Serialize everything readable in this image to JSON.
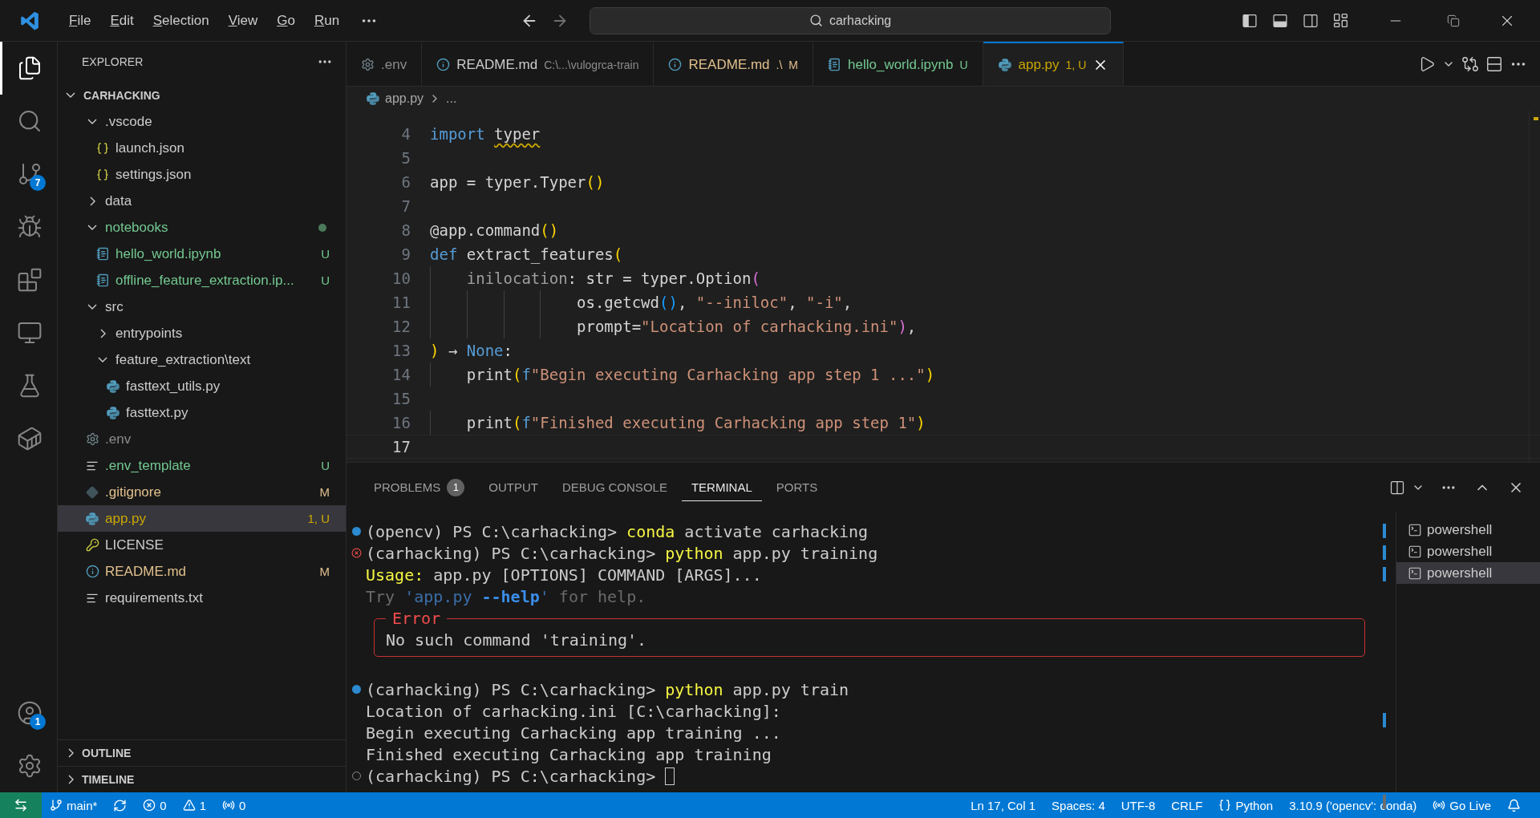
{
  "title_bar": {
    "menu": [
      "File",
      "Edit",
      "Selection",
      "View",
      "Go",
      "Run"
    ],
    "search": {
      "value": "carhacking"
    },
    "layout_toggles": [
      {
        "kind": "sidebar",
        "on": true
      },
      {
        "kind": "panel",
        "on": true
      },
      {
        "kind": "secondary",
        "on": false
      }
    ]
  },
  "activity_bar": {
    "items": [
      {
        "kind": "explorer",
        "selected": true
      },
      {
        "kind": "search",
        "selected": false
      },
      {
        "kind": "source-control",
        "selected": false,
        "badge": "7"
      },
      {
        "kind": "run",
        "selected": false
      },
      {
        "kind": "extensions",
        "selected": false
      },
      {
        "kind": "remote",
        "selected": false
      },
      {
        "kind": "testing",
        "selected": false
      },
      {
        "kind": "docker",
        "selected": false
      }
    ],
    "bottom": [
      {
        "kind": "account",
        "badge": "1"
      },
      {
        "kind": "manage"
      }
    ]
  },
  "sidebar": {
    "title": "EXPLORER",
    "root": {
      "name": "CARHACKING",
      "expanded": true
    },
    "tree": [
      {
        "name": ".vscode",
        "kind": "folder",
        "expanded": true,
        "dot": false,
        "selected": false,
        "children": [
          {
            "name": "launch.json",
            "kind": "json",
            "selected": false
          },
          {
            "name": "settings.json",
            "kind": "json",
            "selected": false
          }
        ]
      },
      {
        "name": "data",
        "kind": "folder",
        "expanded": false,
        "dot": false,
        "selected": false
      },
      {
        "name": "notebooks",
        "kind": "folder",
        "expanded": true,
        "dot": true,
        "color": "#73c991",
        "selected": false,
        "children": [
          {
            "name": "hello_world.ipynb",
            "kind": "notebook",
            "color": "#73c991",
            "decoration": "U",
            "selected": false
          },
          {
            "name": "offline_feature_extraction.ip...",
            "kind": "notebook",
            "color": "#73c991",
            "decoration": "U",
            "selected": false
          }
        ]
      },
      {
        "name": "src",
        "kind": "folder",
        "expanded": true,
        "dot": false,
        "selected": false,
        "children": [
          {
            "name": "entrypoints",
            "kind": "folder",
            "expanded": false,
            "dot": false,
            "selected": false
          },
          {
            "name": "feature_extraction\\text",
            "kind": "folder",
            "expanded": true,
            "dot": false,
            "selected": false,
            "children": [
              {
                "name": "fasttext_utils.py",
                "kind": "python",
                "selected": false
              },
              {
                "name": "fasttext.py",
                "kind": "python",
                "selected": false
              }
            ]
          }
        ]
      },
      {
        "name": ".env",
        "kind": "gear",
        "color": "#8c8c8c",
        "selected": false
      },
      {
        "name": ".env_template",
        "kind": "lines",
        "color": "#73c991",
        "decoration": "U",
        "selected": false
      },
      {
        "name": ".gitignore",
        "kind": "git",
        "color": "#e2c08d",
        "decoration": "M",
        "selected": false
      },
      {
        "name": "app.py",
        "kind": "python",
        "color": "#cca700",
        "decoration": "1, U",
        "selected": true
      },
      {
        "name": "LICENSE",
        "kind": "license",
        "selected": false
      },
      {
        "name": "README.md",
        "kind": "info",
        "color": "#e2c08d",
        "decoration": "M",
        "selected": false
      },
      {
        "name": "requirements.txt",
        "kind": "lines",
        "selected": false
      }
    ],
    "sections": [
      {
        "title": "OUTLINE",
        "expanded": false
      },
      {
        "title": "TIMELINE",
        "expanded": false
      }
    ]
  },
  "tabs": [
    {
      "label": ".env",
      "kind": "gear",
      "color": "#8c8c8c",
      "selected": false
    },
    {
      "label": "README.md",
      "detail": "C:\\...\\vulogrca-train",
      "kind": "info",
      "color": "#cccccc",
      "selected": false
    },
    {
      "label": "README.md",
      "detail": ".\\",
      "decoration": "M",
      "kind": "info",
      "color": "#e2c08d",
      "selected": false
    },
    {
      "label": "hello_world.ipynb",
      "decoration": "U",
      "kind": "notebook",
      "color": "#73c991",
      "selected": false
    },
    {
      "label": "app.py",
      "decoration": "1, U",
      "kind": "python",
      "color": "#cca700",
      "selected": true
    }
  ],
  "breadcrumb": [
    "app.py",
    "..."
  ],
  "editor": {
    "lines": [
      {
        "number": "4",
        "current": false,
        "tokens": [
          {
            "text": "import ",
            "kind": "keyword"
          },
          {
            "text": "typer",
            "kind": "warn"
          }
        ]
      },
      {
        "number": "5",
        "current": false
      },
      {
        "number": "6",
        "current": false,
        "tokens": [
          {
            "text": "app = typer.Typer",
            "kind": "plain"
          },
          {
            "text": "()",
            "kind": "b1"
          }
        ]
      },
      {
        "number": "7",
        "current": false
      },
      {
        "number": "8",
        "current": false,
        "tokens": [
          {
            "text": "@app.command",
            "kind": "plain"
          },
          {
            "text": "()",
            "kind": "b1"
          }
        ]
      },
      {
        "number": "9",
        "current": false,
        "tokens": [
          {
            "text": "def",
            "kind": "keyword"
          },
          {
            "text": " extract_features",
            "kind": "plain"
          },
          {
            "text": "(",
            "kind": "b1"
          }
        ]
      },
      {
        "number": "10",
        "current": false,
        "tokens": [
          {
            "text": "    inilocation",
            "kind": "param"
          },
          {
            "text": ": str = typer.Option",
            "kind": "plain"
          },
          {
            "text": "(",
            "kind": "b2"
          }
        ]
      },
      {
        "number": "11",
        "current": false,
        "tokens": [
          {
            "text": "                os.getcwd",
            "kind": "plain"
          },
          {
            "text": "()",
            "kind": "b3"
          },
          {
            "text": ", ",
            "kind": "plain"
          },
          {
            "text": "\"--iniloc\"",
            "kind": "string"
          },
          {
            "text": ", ",
            "kind": "plain"
          },
          {
            "text": "\"-i\"",
            "kind": "string"
          },
          {
            "text": ",",
            "kind": "plain"
          }
        ]
      },
      {
        "number": "12",
        "current": false,
        "tokens": [
          {
            "text": "                prompt=",
            "kind": "plain"
          },
          {
            "text": "\"Location of carhacking.ini\"",
            "kind": "string"
          },
          {
            "text": ")",
            "kind": "b2"
          },
          {
            "text": ",",
            "kind": "plain"
          }
        ]
      },
      {
        "number": "13",
        "current": false,
        "tokens": [
          {
            "text": ")",
            "kind": "b1"
          },
          {
            "text": " → ",
            "kind": "plain"
          },
          {
            "text": "None",
            "kind": "keyword"
          },
          {
            "text": ":",
            "kind": "plain"
          }
        ]
      },
      {
        "number": "14",
        "current": false,
        "tokens": [
          {
            "text": "    print",
            "kind": "plain"
          },
          {
            "text": "(",
            "kind": "b1"
          },
          {
            "text": "f",
            "kind": "keyword"
          },
          {
            "text": "\"Begin executing Carhacking app step 1 ...\"",
            "kind": "string"
          },
          {
            "text": ")",
            "kind": "b1"
          }
        ]
      },
      {
        "number": "15",
        "current": false
      },
      {
        "number": "16",
        "current": false,
        "tokens": [
          {
            "text": "    print",
            "kind": "plain"
          },
          {
            "text": "(",
            "kind": "b1"
          },
          {
            "text": "f",
            "kind": "keyword"
          },
          {
            "text": "\"Finished executing Carhacking app step 1\"",
            "kind": "string"
          },
          {
            "text": ")",
            "kind": "b1"
          }
        ]
      },
      {
        "number": "17",
        "current": true
      }
    ]
  },
  "panel": {
    "tabs": [
      {
        "label": "PROBLEMS",
        "badge": "1",
        "selected": false
      },
      {
        "label": "OUTPUT",
        "selected": false
      },
      {
        "label": "DEBUG CONSOLE",
        "selected": false
      },
      {
        "label": "TERMINAL",
        "selected": true
      },
      {
        "label": "PORTS",
        "selected": false
      }
    ],
    "terminal": [
      {
        "kind": "success-line",
        "cursor": false,
        "segments": [
          {
            "text": "(opencv) PS C:\\carhacking> ",
            "kind": "plain"
          },
          {
            "text": "conda",
            "kind": "command"
          },
          {
            "text": " activate carhacking",
            "kind": "plain"
          }
        ]
      },
      {
        "kind": "error-line",
        "cursor": false,
        "segments": [
          {
            "text": "(carhacking) PS C:\\carhacking> ",
            "kind": "plain"
          },
          {
            "text": "python",
            "kind": "command"
          },
          {
            "text": " app.py training",
            "kind": "plain"
          }
        ]
      },
      {
        "kind": "output-line",
        "cursor": false,
        "segments": [
          {
            "text": "Usage:",
            "kind": "command"
          },
          {
            "text": " app.py [OPTIONS] COMMAND [ARGS]...",
            "kind": "plain"
          }
        ]
      },
      {
        "kind": "output-line",
        "cursor": false,
        "segments": [
          {
            "text": "Try ",
            "kind": "dim"
          },
          {
            "text": "'app.py ",
            "kind": "link"
          },
          {
            "text": "--help",
            "kind": "link-bold"
          },
          {
            "text": "'",
            "kind": "link"
          },
          {
            "text": " for help.",
            "kind": "dim"
          }
        ]
      },
      {
        "kind": "error-box",
        "title": "Error",
        "text": "No such command 'training'."
      },
      {
        "kind": "success-line",
        "cursor": false,
        "segments": [
          {
            "text": "(carhacking) PS C:\\carhacking> ",
            "kind": "plain"
          },
          {
            "text": "python",
            "kind": "command"
          },
          {
            "text": " app.py train",
            "kind": "plain"
          }
        ]
      },
      {
        "kind": "output-line",
        "cursor": false,
        "segments": [
          {
            "text": "Location of carhacking.ini [C:\\carhacking]:",
            "kind": "plain"
          }
        ]
      },
      {
        "kind": "output-line",
        "cursor": false,
        "segments": [
          {
            "text": "Begin executing Carhacking app training ...",
            "kind": "plain"
          }
        ]
      },
      {
        "kind": "output-line",
        "cursor": false,
        "segments": [
          {
            "text": "Finished executing Carhacking app training",
            "kind": "plain"
          }
        ]
      },
      {
        "kind": "idle-line",
        "cursor": true,
        "segments": [
          {
            "text": "(carhacking) PS C:\\carhacking> ",
            "kind": "plain"
          }
        ]
      }
    ],
    "terminals": [
      {
        "label": "powershell",
        "selected": false
      },
      {
        "label": "powershell",
        "selected": false
      },
      {
        "label": "powershell",
        "selected": true
      }
    ]
  },
  "status_bar": {
    "left": [
      {
        "kind": "branch",
        "text": "main*"
      },
      {
        "kind": "sync"
      },
      {
        "kind": "errors",
        "text": "0"
      },
      {
        "kind": "warnings",
        "text": "1"
      },
      {
        "kind": "ports",
        "text": "0"
      }
    ],
    "right": [
      {
        "kind": "text",
        "text": "Ln 17, Col 1"
      },
      {
        "kind": "text",
        "text": "Spaces: 4"
      },
      {
        "kind": "text",
        "text": "UTF-8"
      },
      {
        "kind": "text",
        "text": "CRLF"
      },
      {
        "kind": "language",
        "text": "Python"
      },
      {
        "kind": "text",
        "text": "3.10.9 ('opencv': conda)"
      },
      {
        "kind": "live",
        "text": "Go Live"
      },
      {
        "kind": "bell"
      }
    ]
  }
}
